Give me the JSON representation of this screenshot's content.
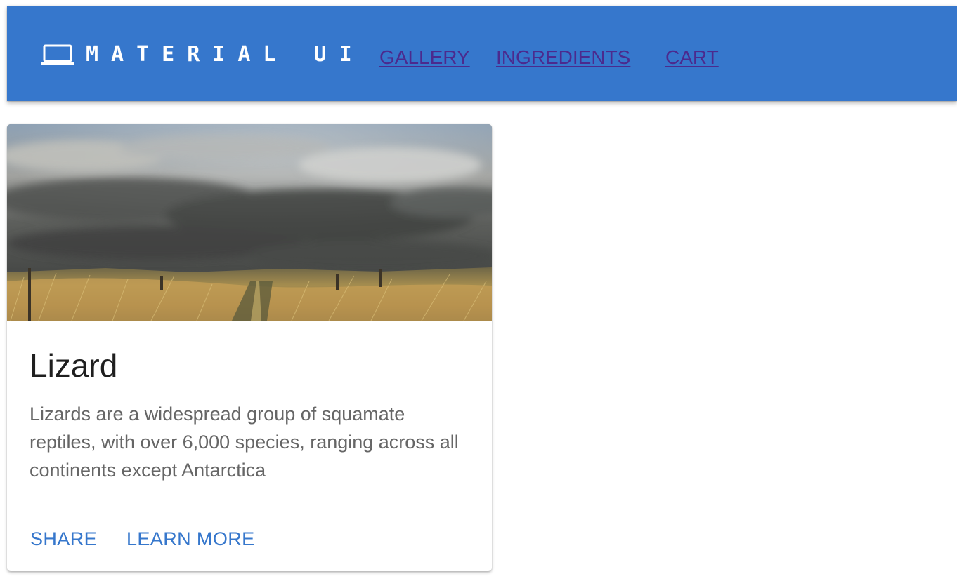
{
  "app_bar": {
    "brand_icon": "laptop-icon",
    "brand_text": "MATERIAL UI",
    "nav_links": [
      {
        "label": "GALLERY"
      },
      {
        "label": "INGREDIENTS"
      },
      {
        "label": "CART"
      }
    ]
  },
  "card": {
    "image": {
      "alt": "",
      "description_icon": "landscape-image"
    },
    "title": "Lizard",
    "description": "Lizards are a widespread group of squamate reptiles, with over 6,000 species, ranging across all continents except Antarctica",
    "actions": [
      {
        "label": "SHARE"
      },
      {
        "label": "LEARN MORE"
      }
    ]
  },
  "colors": {
    "app_bar_background": "#3677cc",
    "nav_link_color": "#4b2a8e",
    "button_color": "#3677cc",
    "title_color": "#1f1f1f",
    "body_text_color": "#666666"
  }
}
